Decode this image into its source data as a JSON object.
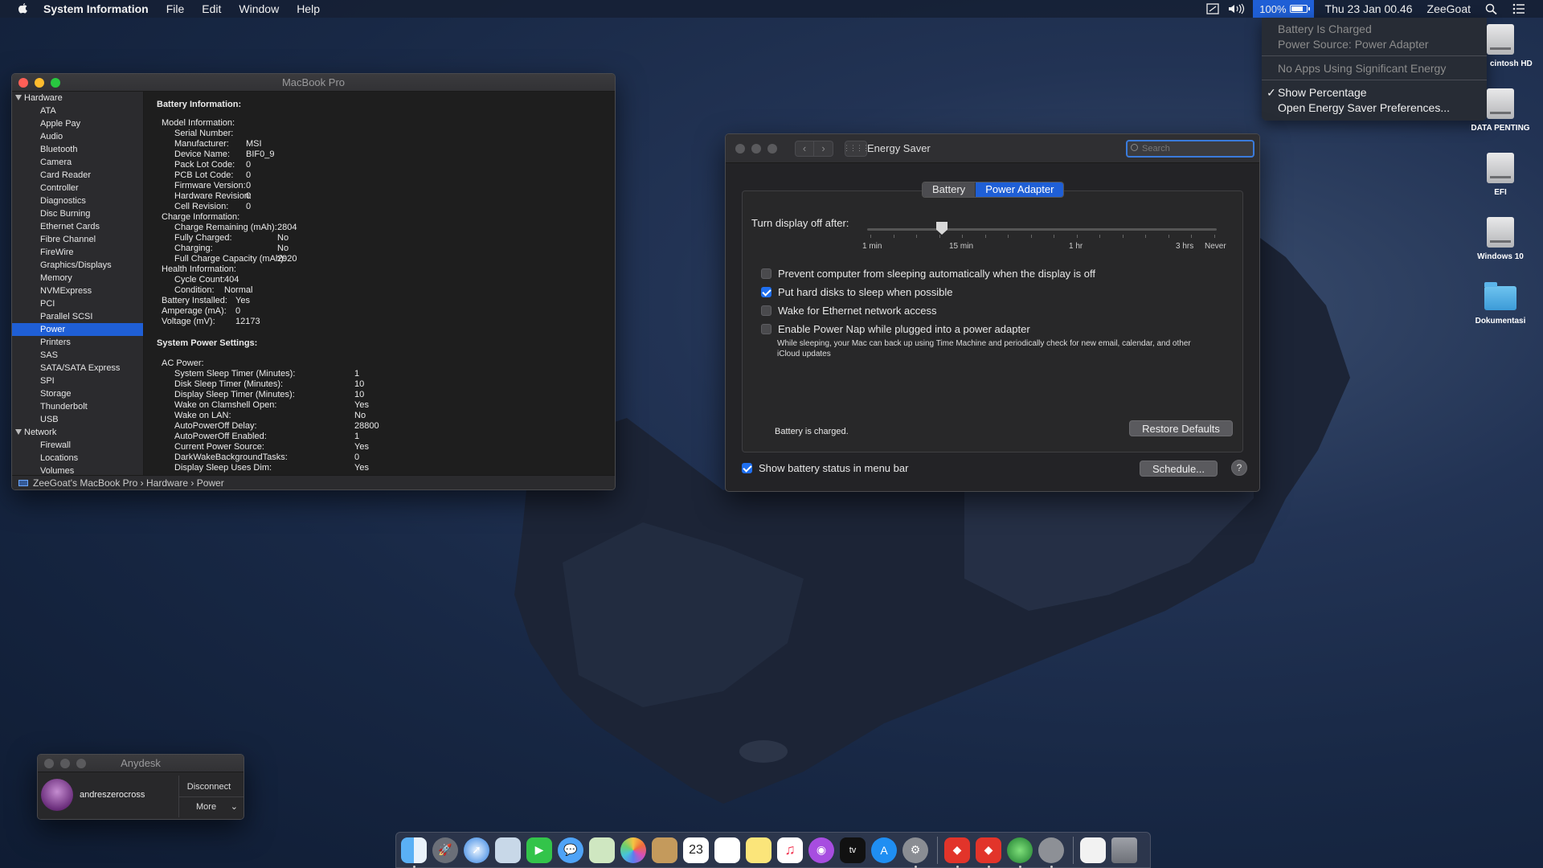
{
  "menubar": {
    "app_name": "System Information",
    "menus": [
      "File",
      "Edit",
      "Window",
      "Help"
    ],
    "battery_percent": "100%",
    "clock": "Thu 23 Jan  00.46",
    "user": "ZeeGoat"
  },
  "battery_menu": {
    "status": "Battery Is Charged",
    "power_source": "Power Source: Power Adapter",
    "apps": "No Apps Using Significant Energy",
    "show_percentage": "Show Percentage",
    "open_prefs": "Open Energy Saver Preferences..."
  },
  "desktop_icons": [
    "cintosh HD",
    "DATA PENTING",
    "EFI",
    "Windows 10",
    "Dokumentasi"
  ],
  "sysinfo": {
    "title": "MacBook Pro",
    "sidebar": {
      "hardware_label": "Hardware",
      "hardware_items": [
        "ATA",
        "Apple Pay",
        "Audio",
        "Bluetooth",
        "Camera",
        "Card Reader",
        "Controller",
        "Diagnostics",
        "Disc Burning",
        "Ethernet Cards",
        "Fibre Channel",
        "FireWire",
        "Graphics/Displays",
        "Memory",
        "NVMExpress",
        "PCI",
        "Parallel SCSI",
        "Power",
        "Printers",
        "SAS",
        "SATA/SATA Express",
        "SPI",
        "Storage",
        "Thunderbolt",
        "USB"
      ],
      "selected": "Power",
      "network_label": "Network",
      "network_items": [
        "Firewall",
        "Locations",
        "Volumes"
      ]
    },
    "battery_heading": "Battery Information:",
    "battery_rows": [
      {
        "k": "Model Information:",
        "v": "",
        "indent": 0
      },
      {
        "k": "Serial Number:",
        "v": "",
        "indent": 1
      },
      {
        "k": "Manufacturer:",
        "v": "MSI",
        "indent": 1
      },
      {
        "k": "Device Name:",
        "v": "BIF0_9",
        "indent": 1
      },
      {
        "k": "Pack Lot Code:",
        "v": "0",
        "indent": 1
      },
      {
        "k": "PCB Lot Code:",
        "v": "0",
        "indent": 1
      },
      {
        "k": "Firmware Version:",
        "v": "0",
        "indent": 1
      },
      {
        "k": "Hardware Revision:",
        "v": "0",
        "indent": 1
      },
      {
        "k": "Cell Revision:",
        "v": "0",
        "indent": 1
      },
      {
        "k": "Charge Information:",
        "v": "",
        "indent": 0
      },
      {
        "k": "Charge Remaining (mAh):",
        "v": "2804",
        "indent": 2
      },
      {
        "k": "Fully Charged:",
        "v": "No",
        "indent": 2
      },
      {
        "k": "Charging:",
        "v": "No",
        "indent": 2
      },
      {
        "k": "Full Charge Capacity (mAh):",
        "v": "2920",
        "indent": 2
      },
      {
        "k": "Health Information:",
        "v": "",
        "indent": 0
      },
      {
        "k": "Cycle Count:",
        "v": "404",
        "indent": 3
      },
      {
        "k": "Condition:",
        "v": "Normal",
        "indent": 4
      },
      {
        "k": "Battery Installed:",
        "v": "Yes",
        "indent": 5
      },
      {
        "k": "Amperage (mA):",
        "v": "0",
        "indent": 6
      },
      {
        "k": "Voltage (mV):",
        "v": "12173",
        "indent": 7
      }
    ],
    "power_heading": "System Power Settings:",
    "ac_label": "AC Power:",
    "power_rows": [
      {
        "k": "System Sleep Timer (Minutes):",
        "v": "1"
      },
      {
        "k": "Disk Sleep Timer (Minutes):",
        "v": "10"
      },
      {
        "k": "Display Sleep Timer (Minutes):",
        "v": "10"
      },
      {
        "k": "Wake on Clamshell Open:",
        "v": "Yes"
      },
      {
        "k": "Wake on LAN:",
        "v": "No"
      },
      {
        "k": "AutoPowerOff Delay:",
        "v": "28800"
      },
      {
        "k": "AutoPowerOff Enabled:",
        "v": "1"
      },
      {
        "k": "Current Power Source:",
        "v": "Yes"
      },
      {
        "k": "DarkWakeBackgroundTasks:",
        "v": "0"
      },
      {
        "k": "Display Sleep Uses Dim:",
        "v": "Yes"
      }
    ],
    "path": "ZeeGoat's MacBook Pro  ›  Hardware  ›  Power"
  },
  "energy": {
    "title": "Energy Saver",
    "search_placeholder": "Search",
    "tabs": [
      "Battery",
      "Power Adapter"
    ],
    "active_tab": "Power Adapter",
    "display_off_label": "Turn display off after:",
    "slider_value": "15 min",
    "ticks": [
      "1 min",
      "15 min",
      "1 hr",
      "3 hrs",
      "Never"
    ],
    "options": [
      {
        "label": "Prevent computer from sleeping automatically when the display is off",
        "checked": false
      },
      {
        "label": "Put hard disks to sleep when possible",
        "checked": true
      },
      {
        "label": "Wake for Ethernet network access",
        "checked": false
      },
      {
        "label": "Enable Power Nap while plugged into a power adapter",
        "checked": false
      }
    ],
    "power_nap_note": "While sleeping, your Mac can back up using Time Machine and periodically check for new email, calendar, and other iCloud updates",
    "battery_status": "Battery is charged.",
    "restore_btn": "Restore Defaults",
    "show_status_label": "Show battery status in menu bar",
    "show_status_checked": true,
    "schedule_btn": "Schedule...",
    "help": "?"
  },
  "anydesk": {
    "title": "Anydesk",
    "user": "andreszerocross",
    "disconnect": "Disconnect",
    "more": "More"
  },
  "dock": {
    "calendar_day": "23",
    "apps": [
      "finder-icon",
      "launchpad-icon",
      "safari-icon",
      "preview-icon",
      "facetime-icon",
      "messages-icon",
      "maps-icon",
      "photos-icon",
      "contacts-icon",
      "calendar-icon",
      "reminders-icon",
      "notes-icon",
      "music-icon",
      "podcasts-icon",
      "tv-icon",
      "appstore-icon",
      "system-preferences-icon",
      "anydesk-icon",
      "anydesk-alt-icon",
      "globe-app-icon",
      "automator-icon",
      "documents-icon",
      "trash-icon"
    ],
    "tv_label": "tv"
  },
  "colors": {
    "accent": "#1f5fd6",
    "window_bg": "#1e1e1e"
  }
}
